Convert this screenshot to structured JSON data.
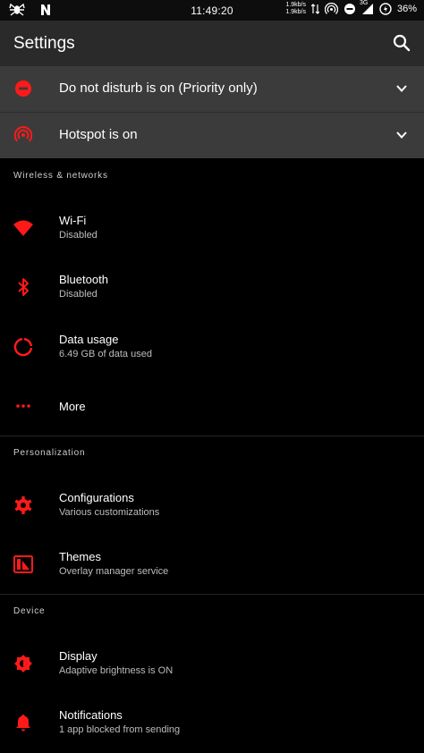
{
  "status_bar": {
    "time": "11:49:20",
    "speed_up": "1.9kb/s",
    "speed_down": "1.9kb/s",
    "network": "3G",
    "battery": "36%"
  },
  "app_bar": {
    "title": "Settings"
  },
  "conditions": [
    {
      "label": "Do not disturb is on (Priority only)",
      "icon": "do-not-disturb-icon"
    },
    {
      "label": "Hotspot is on",
      "icon": "hotspot-icon"
    }
  ],
  "sections": {
    "wireless": {
      "header": "Wireless & networks",
      "items": [
        {
          "title": "Wi-Fi",
          "subtitle": "Disabled",
          "icon": "wifi-icon"
        },
        {
          "title": "Bluetooth",
          "subtitle": "Disabled",
          "icon": "bluetooth-icon"
        },
        {
          "title": "Data usage",
          "subtitle": "6.49 GB of data used",
          "icon": "data-usage-icon"
        },
        {
          "title": "More",
          "icon": "more-icon"
        }
      ]
    },
    "personalization": {
      "header": "Personalization",
      "items": [
        {
          "title": "Configurations",
          "subtitle": "Various customizations",
          "icon": "gear-icon"
        },
        {
          "title": "Themes",
          "subtitle": "Overlay manager service",
          "icon": "themes-icon"
        }
      ]
    },
    "device": {
      "header": "Device",
      "items": [
        {
          "title": "Display",
          "subtitle": "Adaptive brightness is ON",
          "icon": "brightness-icon"
        },
        {
          "title": "Notifications",
          "subtitle": "1 app blocked from sending",
          "icon": "bell-icon"
        }
      ]
    }
  },
  "colors": {
    "accent": "#ff1a1a",
    "background": "#000000",
    "app_bar": "#2a2a2a",
    "condition": "#3b3b3b"
  }
}
